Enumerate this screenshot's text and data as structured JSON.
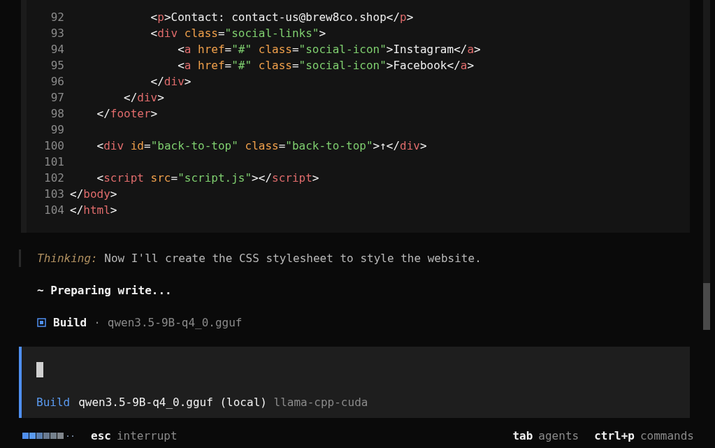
{
  "code": {
    "lines": [
      {
        "number": "92",
        "tokens": [
          {
            "kind": "punct",
            "text": "            <"
          },
          {
            "kind": "tag",
            "text": "p"
          },
          {
            "kind": "punct",
            "text": ">Contact: contact-us@brew8co.shop</"
          },
          {
            "kind": "tag",
            "text": "p"
          },
          {
            "kind": "punct",
            "text": ">"
          }
        ]
      },
      {
        "number": "93",
        "tokens": [
          {
            "kind": "punct",
            "text": "            <"
          },
          {
            "kind": "tag",
            "text": "div"
          },
          {
            "kind": "attr",
            "text": " class"
          },
          {
            "kind": "punct",
            "text": "="
          },
          {
            "kind": "str",
            "text": "\"social-links\""
          },
          {
            "kind": "punct",
            "text": ">"
          }
        ]
      },
      {
        "number": "94",
        "tokens": [
          {
            "kind": "punct",
            "text": "                <"
          },
          {
            "kind": "tag",
            "text": "a"
          },
          {
            "kind": "attr",
            "text": " href"
          },
          {
            "kind": "punct",
            "text": "="
          },
          {
            "kind": "str",
            "text": "\"#\""
          },
          {
            "kind": "attr",
            "text": " class"
          },
          {
            "kind": "punct",
            "text": "="
          },
          {
            "kind": "str",
            "text": "\"social-icon\""
          },
          {
            "kind": "punct",
            "text": ">Instagram</"
          },
          {
            "kind": "tag",
            "text": "a"
          },
          {
            "kind": "punct",
            "text": ">"
          }
        ]
      },
      {
        "number": "95",
        "tokens": [
          {
            "kind": "punct",
            "text": "                <"
          },
          {
            "kind": "tag",
            "text": "a"
          },
          {
            "kind": "attr",
            "text": " href"
          },
          {
            "kind": "punct",
            "text": "="
          },
          {
            "kind": "str",
            "text": "\"#\""
          },
          {
            "kind": "attr",
            "text": " class"
          },
          {
            "kind": "punct",
            "text": "="
          },
          {
            "kind": "str",
            "text": "\"social-icon\""
          },
          {
            "kind": "punct",
            "text": ">Facebook</"
          },
          {
            "kind": "tag",
            "text": "a"
          },
          {
            "kind": "punct",
            "text": ">"
          }
        ]
      },
      {
        "number": "96",
        "tokens": [
          {
            "kind": "punct",
            "text": "            </"
          },
          {
            "kind": "tag",
            "text": "div"
          },
          {
            "kind": "punct",
            "text": ">"
          }
        ]
      },
      {
        "number": "97",
        "tokens": [
          {
            "kind": "punct",
            "text": "        </"
          },
          {
            "kind": "tag",
            "text": "div"
          },
          {
            "kind": "punct",
            "text": ">"
          }
        ]
      },
      {
        "number": "98",
        "tokens": [
          {
            "kind": "punct",
            "text": "    </"
          },
          {
            "kind": "tag",
            "text": "footer"
          },
          {
            "kind": "punct",
            "text": ">"
          }
        ]
      },
      {
        "number": "99"
      },
      {
        "number": "100",
        "tokens": [
          {
            "kind": "punct",
            "text": "    <"
          },
          {
            "kind": "tag",
            "text": "div"
          },
          {
            "kind": "attr",
            "text": " id"
          },
          {
            "kind": "punct",
            "text": "="
          },
          {
            "kind": "str",
            "text": "\"back-to-top\""
          },
          {
            "kind": "attr",
            "text": " class"
          },
          {
            "kind": "punct",
            "text": "="
          },
          {
            "kind": "str",
            "text": "\"back-to-top\""
          },
          {
            "kind": "punct",
            "text": ">↑</"
          },
          {
            "kind": "tag",
            "text": "div"
          },
          {
            "kind": "punct",
            "text": ">"
          }
        ]
      },
      {
        "number": "101"
      },
      {
        "number": "102",
        "tokens": [
          {
            "kind": "punct",
            "text": "    <"
          },
          {
            "kind": "tag",
            "text": "script"
          },
          {
            "kind": "attr",
            "text": " src"
          },
          {
            "kind": "punct",
            "text": "="
          },
          {
            "kind": "str",
            "text": "\"script.js\""
          },
          {
            "kind": "punct",
            "text": "></"
          },
          {
            "kind": "tag",
            "text": "script"
          },
          {
            "kind": "punct",
            "text": ">"
          }
        ]
      },
      {
        "number": "103",
        "tokens": [
          {
            "kind": "punct",
            "text": "</"
          },
          {
            "kind": "tag",
            "text": "body"
          },
          {
            "kind": "punct",
            "text": ">"
          }
        ]
      },
      {
        "number": "104",
        "tokens": [
          {
            "kind": "punct",
            "text": "</"
          },
          {
            "kind": "tag",
            "text": "html"
          },
          {
            "kind": "punct",
            "text": ">"
          }
        ]
      }
    ]
  },
  "thinking": {
    "label": "Thinking:",
    "text": "Now I'll create the CSS stylesheet to style the website."
  },
  "status": "~ Preparing write...",
  "agent": {
    "name": "Build",
    "separator": "·",
    "model": "qwen3.5-9B-q4_0.gguf"
  },
  "prompt": {
    "agent": "Build",
    "model": "qwen3.5-9B-q4_0.gguf (local)",
    "provider": "llama-cpp-cuda"
  },
  "footer": {
    "left": [
      {
        "key": "esc",
        "action": "interrupt"
      }
    ],
    "right": [
      {
        "key": "tab",
        "action": "agents"
      },
      {
        "key": "ctrl+p",
        "action": "commands"
      }
    ]
  }
}
